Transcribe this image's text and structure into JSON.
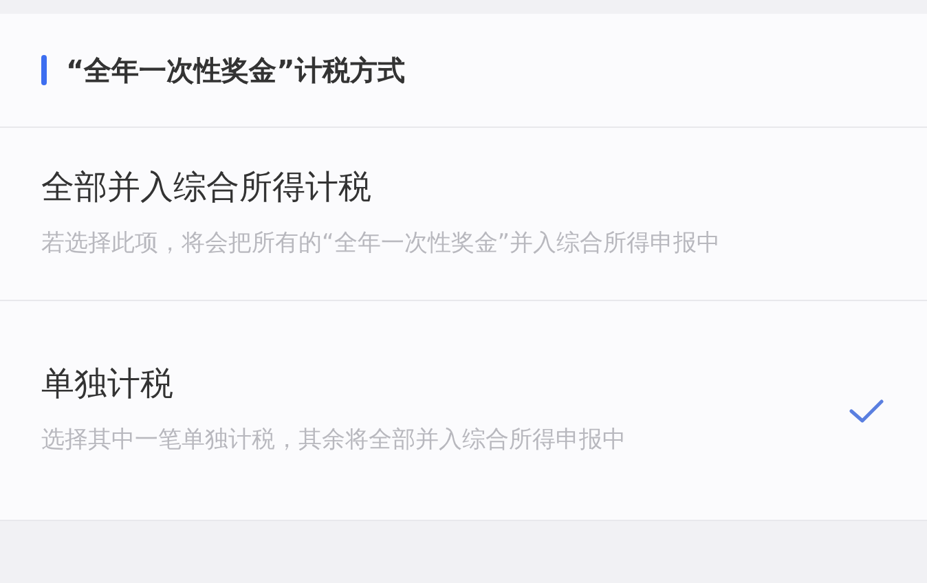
{
  "section": {
    "title": "“全年一次性奖金”计税方式"
  },
  "options": [
    {
      "title": "全部并入综合所得计税",
      "description": "若选择此项，将会把所有的“全年一次性奖金”并入综合所得申报中",
      "selected": false
    },
    {
      "title": "单独计税",
      "description": "选择其中一笔单独计税，其余将全部并入综合所得申报中",
      "selected": true
    }
  ]
}
